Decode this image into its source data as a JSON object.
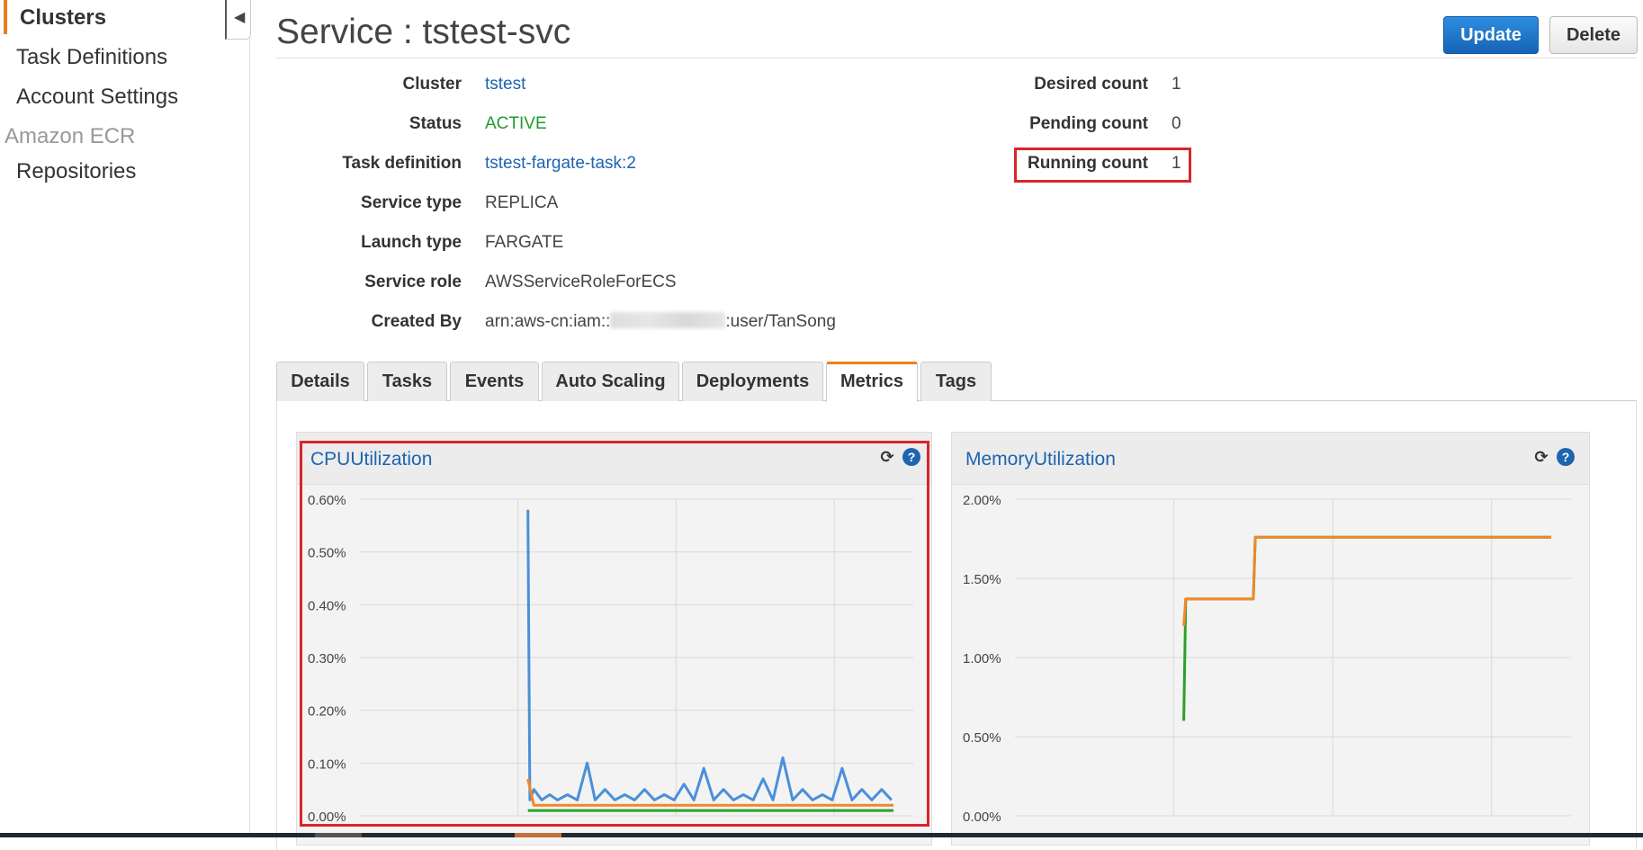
{
  "sidebar": {
    "items": [
      {
        "label": "Clusters",
        "active": true
      },
      {
        "label": "Task Definitions"
      },
      {
        "label": "Account Settings"
      }
    ],
    "section": "Amazon ECR",
    "section_items": [
      {
        "label": "Repositories"
      }
    ],
    "collapse_icon": "caret-left-icon"
  },
  "header": {
    "title": "Service : tstest-svc",
    "update_label": "Update",
    "delete_label": "Delete"
  },
  "details_left": [
    {
      "label": "Cluster",
      "value": "tstest",
      "link": true
    },
    {
      "label": "Status",
      "value": "ACTIVE"
    },
    {
      "label": "Task definition",
      "value": "tstest-fargate-task:2",
      "link": true
    },
    {
      "label": "Service type",
      "value": "REPLICA"
    },
    {
      "label": "Launch type",
      "value": "FARGATE"
    },
    {
      "label": "Service role",
      "value": "AWSServiceRoleForECS"
    },
    {
      "label": "Created By",
      "value_prefix": "arn:aws-cn:iam::",
      "value_suffix": ":user/TanSong"
    }
  ],
  "details_right": [
    {
      "label": "Desired count",
      "value": "1"
    },
    {
      "label": "Pending count",
      "value": "0"
    },
    {
      "label": "Running count",
      "value": "1"
    }
  ],
  "tabs": [
    {
      "label": "Details"
    },
    {
      "label": "Tasks"
    },
    {
      "label": "Events"
    },
    {
      "label": "Auto Scaling"
    },
    {
      "label": "Deployments"
    },
    {
      "label": "Metrics",
      "active": true
    },
    {
      "label": "Tags"
    }
  ],
  "colors": {
    "accent": "#e7811e",
    "link": "#1f64b0",
    "status_active": "#1d9d2c",
    "highlight": "#d9252b",
    "series_blue": "#4a90d9",
    "series_orange": "#f0882a",
    "series_green": "#2ca02c"
  },
  "widgets": {
    "cpu": {
      "title": "CPUUtilization",
      "refresh_icon": "refresh-icon",
      "help_icon": "help-icon"
    },
    "memory": {
      "title": "MemoryUtilization",
      "refresh_icon": "refresh-icon",
      "help_icon": "help-icon"
    }
  },
  "chart_data": [
    {
      "type": "line",
      "title": "CPUUtilization",
      "y_ticks": [
        "0.60%",
        "0.50%",
        "0.40%",
        "0.30%",
        "0.20%",
        "0.10%",
        "0.00%"
      ],
      "ylim": [
        0,
        0.6
      ],
      "x_range_hours": [
        0,
        28
      ],
      "grid": true,
      "series": [
        {
          "color": "#4a90d9",
          "x": [
            8.5,
            8.6,
            8.8,
            9.2,
            9.6,
            10.0,
            10.5,
            11.0,
            11.5,
            11.9,
            12.4,
            12.9,
            13.4,
            13.9,
            14.4,
            14.9,
            15.4,
            15.9,
            16.4,
            16.9,
            17.4,
            17.9,
            18.4,
            18.9,
            19.4,
            19.9,
            20.4,
            20.9,
            21.4,
            21.9,
            22.4,
            22.9,
            23.4,
            23.9,
            24.4,
            24.9,
            25.4,
            25.9,
            26.4,
            26.9
          ],
          "y": [
            0.58,
            0.03,
            0.05,
            0.03,
            0.04,
            0.03,
            0.04,
            0.03,
            0.1,
            0.03,
            0.05,
            0.03,
            0.04,
            0.03,
            0.05,
            0.03,
            0.04,
            0.03,
            0.06,
            0.03,
            0.09,
            0.03,
            0.05,
            0.03,
            0.04,
            0.03,
            0.07,
            0.03,
            0.11,
            0.03,
            0.05,
            0.03,
            0.04,
            0.03,
            0.09,
            0.03,
            0.05,
            0.03,
            0.05,
            0.03
          ]
        },
        {
          "color": "#f0882a",
          "x": [
            8.5,
            8.8,
            27.0
          ],
          "y": [
            0.07,
            0.02,
            0.02
          ]
        },
        {
          "color": "#2ca02c",
          "x": [
            8.5,
            27.0
          ],
          "y": [
            0.01,
            0.01
          ]
        }
      ]
    },
    {
      "type": "line",
      "title": "MemoryUtilization",
      "y_ticks": [
        "2.00%",
        "1.50%",
        "1.00%",
        "0.50%",
        "0.00%"
      ],
      "ylim": [
        0,
        2.0
      ],
      "x_range_hours": [
        0,
        28
      ],
      "grid": true,
      "series": [
        {
          "color": "#2ca02c",
          "x": [
            8.5,
            8.6,
            12.0,
            12.1,
            27.0
          ],
          "y": [
            0.6,
            1.37,
            1.37,
            1.76,
            1.76
          ]
        },
        {
          "color": "#f0882a",
          "x": [
            8.5,
            8.6,
            12.0,
            12.1,
            27.0
          ],
          "y": [
            1.2,
            1.37,
            1.37,
            1.76,
            1.76
          ]
        }
      ]
    }
  ]
}
